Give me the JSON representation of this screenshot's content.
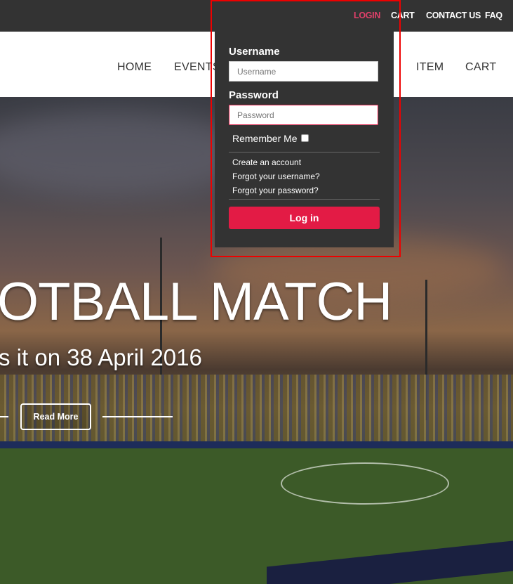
{
  "topbar": {
    "links": [
      {
        "label": "LOGIN",
        "active": true
      },
      {
        "label": "CART"
      },
      {
        "label": "CONTACT US"
      },
      {
        "label": "FAQ"
      }
    ],
    "active_color": "#e0406a"
  },
  "nav": {
    "items": [
      "HOME",
      "EVENTS",
      "ITEM",
      "CART"
    ]
  },
  "hero": {
    "title": "OTBALL MATCH",
    "subtitle": "s it on 38 April 2016",
    "read_more": "Read More"
  },
  "login": {
    "username_label": "Username",
    "username_placeholder": "Username",
    "password_label": "Password",
    "password_placeholder": "Password",
    "remember_label": "Remember Me",
    "remember_checked": false,
    "create_account": "Create an account",
    "forgot_username": "Forgot your username?",
    "forgot_password": "Forgot your password?",
    "submit": "Log in",
    "accent": "#e31b45"
  }
}
